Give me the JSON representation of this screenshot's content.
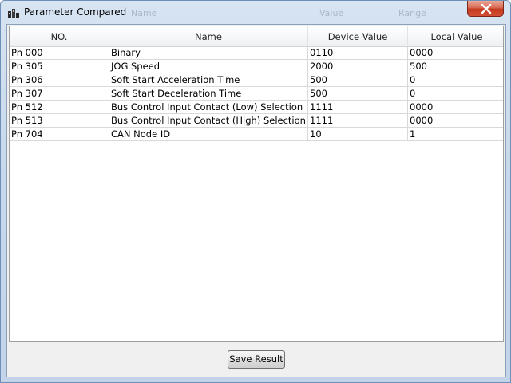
{
  "window": {
    "title": "Parameter Compared",
    "ghost_labels": [
      "Name",
      "Value",
      "Range"
    ]
  },
  "table": {
    "columns": [
      "NO.",
      "Name",
      "Device Value",
      "Local Value"
    ],
    "rows": [
      [
        "Pn 000",
        "Binary",
        "0110",
        "0000"
      ],
      [
        "Pn 305",
        "JOG Speed",
        "2000",
        "500"
      ],
      [
        "Pn 306",
        "Soft Start Acceleration Time",
        "500",
        "0"
      ],
      [
        "Pn 307",
        "Soft Start Deceleration Time",
        "500",
        "0"
      ],
      [
        "Pn 512",
        "Bus Control Input Contact (Low) Selection",
        "1111",
        "0000"
      ],
      [
        "Pn 513",
        "Bus Control Input Contact (High) Selection",
        "1111",
        "0000"
      ],
      [
        "Pn 704",
        "CAN Node ID",
        "10",
        "1"
      ]
    ]
  },
  "footer": {
    "save_label": "Save Result"
  },
  "colors": {
    "close_button": "#c4391f",
    "grid_lines": "#d9d9d9"
  }
}
